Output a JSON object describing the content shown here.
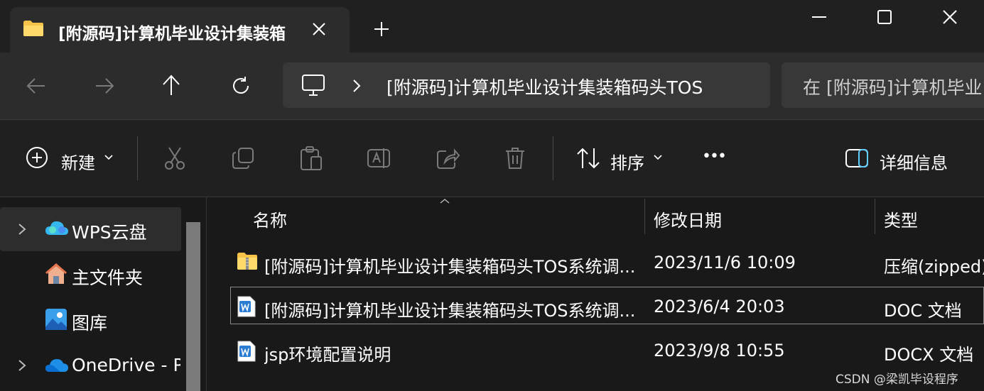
{
  "window": {
    "tab_title": "[附源码]计算机毕业设计集装箱",
    "tab_close_icon": "close-icon",
    "new_tab_icon": "plus-icon",
    "minimize_icon": "minimize-icon",
    "maximize_icon": "maximize-icon",
    "close_icon": "close-icon"
  },
  "nav": {
    "address_path": "[附源码]计算机毕业设计集装箱码头TOS",
    "search_placeholder": "在 [附源码]计算机毕业"
  },
  "toolbar": {
    "new_label": "新建",
    "sort_label": "排序",
    "more_label": "•••",
    "details_label": "详细信息"
  },
  "sidebar": {
    "items": [
      {
        "label": "WPS云盘",
        "icon": "cloud-icon"
      },
      {
        "label": "主文件夹",
        "icon": "home-icon"
      },
      {
        "label": "图库",
        "icon": "gallery-icon"
      },
      {
        "label": "OneDrive - Pe",
        "icon": "onedrive-icon"
      }
    ]
  },
  "filelist": {
    "columns": [
      "名称",
      "修改日期",
      "类型"
    ],
    "rows": [
      {
        "name": "[附源码]计算机毕业设计集装箱码头TOS系统调...",
        "date": "2023/11/6 10:09",
        "type": "压缩(zipped)",
        "icon": "zip-folder-icon"
      },
      {
        "name": "[附源码]计算机毕业设计集装箱码头TOS系统调...",
        "date": "2023/6/4 20:03",
        "type": "DOC 文档",
        "icon": "word-doc-icon"
      },
      {
        "name": "jsp环境配置说明",
        "date": "2023/9/8 10:55",
        "type": "DOCX 文档",
        "icon": "word-doc-icon"
      }
    ]
  },
  "watermark": "CSDN @梁凯毕设程序",
  "colors": {
    "accent": "#60cdff",
    "folder": "#f7c44a",
    "word": "#2b7cd3"
  }
}
